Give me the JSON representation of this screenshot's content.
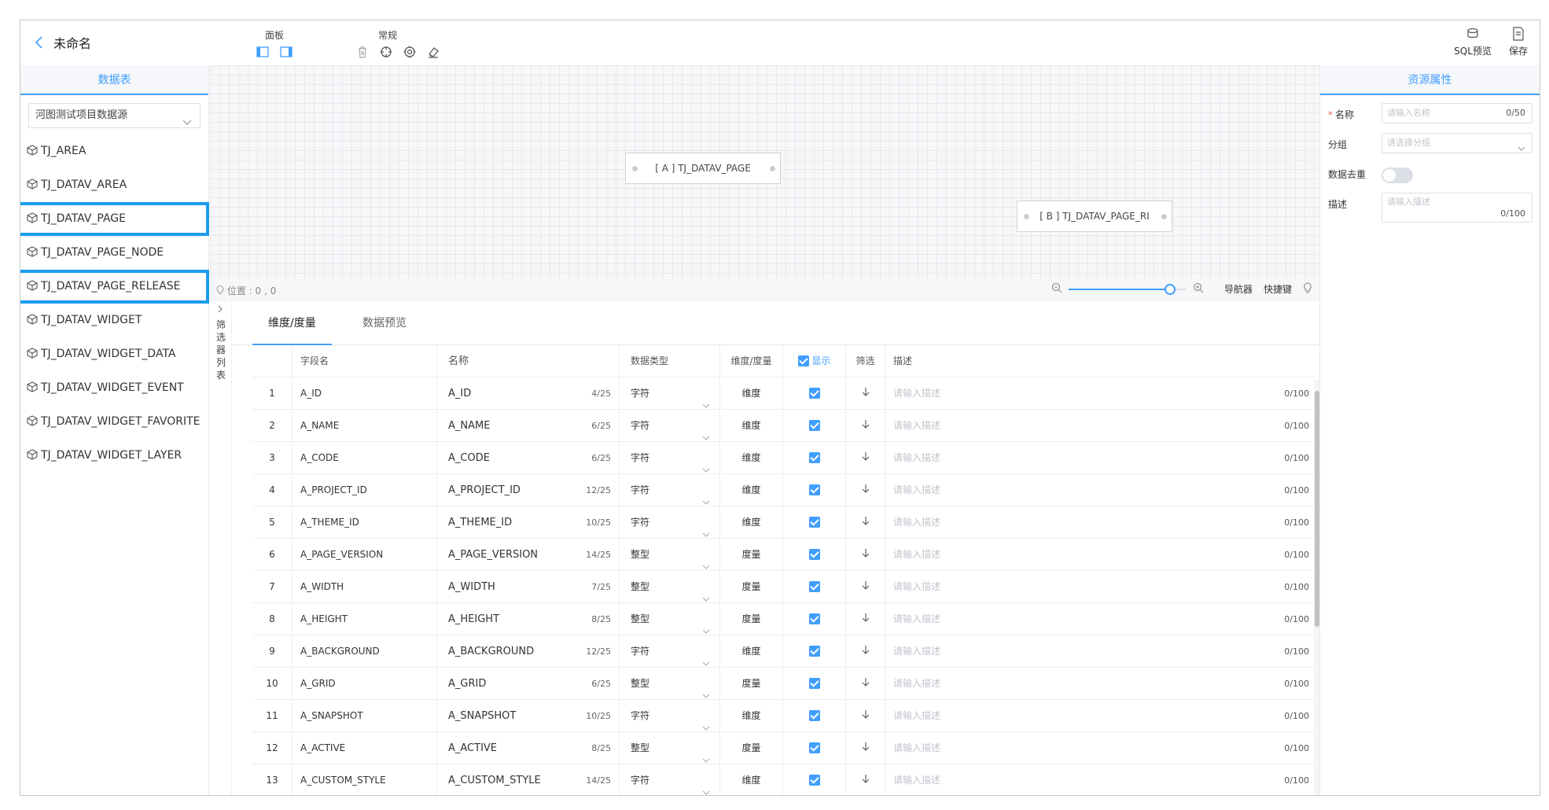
{
  "header": {
    "title": "未命名",
    "panel_label": "面板",
    "common_label": "常规",
    "sql_preview_label": "SQL预览",
    "save_label": "保存"
  },
  "left_panel": {
    "title": "数据表",
    "datasource": "河图测试项目数据源",
    "tables": [
      "TJ_AREA",
      "TJ_DATAV_AREA",
      "TJ_DATAV_PAGE",
      "TJ_DATAV_PAGE_NODE",
      "TJ_DATAV_PAGE_RELEASE",
      "TJ_DATAV_WIDGET",
      "TJ_DATAV_WIDGET_DATA",
      "TJ_DATAV_WIDGET_EVENT",
      "TJ_DATAV_WIDGET_FAVORITE",
      "TJ_DATAV_WIDGET_LAYER"
    ]
  },
  "canvas": {
    "node_a": "[ A ] TJ_DATAV_PAGE",
    "node_b": "[ B ] TJ_DATAV_PAGE_RI",
    "position": "位置 : 0 , 0",
    "navigator_label": "导航器",
    "shortcut_label": "快捷键",
    "zoom_level": 1.0
  },
  "filter_strip": {
    "label": "筛选器列表"
  },
  "bottom": {
    "tabs": [
      "维度/度量",
      "数据预览"
    ],
    "columns": {
      "field": "字段名",
      "name": "名称",
      "type": "数据类型",
      "dim": "维度/度量",
      "show": "显示",
      "filter": "筛选",
      "desc": "描述"
    },
    "desc_placeholder": "请输入描述",
    "desc_count": "0/100",
    "rows": [
      {
        "idx": "1",
        "field": "A_ID",
        "name": "A_ID",
        "count": "4/25",
        "type": "字符",
        "dim": "维度"
      },
      {
        "idx": "2",
        "field": "A_NAME",
        "name": "A_NAME",
        "count": "6/25",
        "type": "字符",
        "dim": "维度"
      },
      {
        "idx": "3",
        "field": "A_CODE",
        "name": "A_CODE",
        "count": "6/25",
        "type": "字符",
        "dim": "维度"
      },
      {
        "idx": "4",
        "field": "A_PROJECT_ID",
        "name": "A_PROJECT_ID",
        "count": "12/25",
        "type": "字符",
        "dim": "维度"
      },
      {
        "idx": "5",
        "field": "A_THEME_ID",
        "name": "A_THEME_ID",
        "count": "10/25",
        "type": "字符",
        "dim": "维度"
      },
      {
        "idx": "6",
        "field": "A_PAGE_VERSION",
        "name": "A_PAGE_VERSION",
        "count": "14/25",
        "type": "整型",
        "dim": "度量"
      },
      {
        "idx": "7",
        "field": "A_WIDTH",
        "name": "A_WIDTH",
        "count": "7/25",
        "type": "整型",
        "dim": "度量"
      },
      {
        "idx": "8",
        "field": "A_HEIGHT",
        "name": "A_HEIGHT",
        "count": "8/25",
        "type": "整型",
        "dim": "度量"
      },
      {
        "idx": "9",
        "field": "A_BACKGROUND",
        "name": "A_BACKGROUND",
        "count": "12/25",
        "type": "字符",
        "dim": "维度"
      },
      {
        "idx": "10",
        "field": "A_GRID",
        "name": "A_GRID",
        "count": "6/25",
        "type": "整型",
        "dim": "度量"
      },
      {
        "idx": "11",
        "field": "A_SNAPSHOT",
        "name": "A_SNAPSHOT",
        "count": "10/25",
        "type": "字符",
        "dim": "维度"
      },
      {
        "idx": "12",
        "field": "A_ACTIVE",
        "name": "A_ACTIVE",
        "count": "8/25",
        "type": "整型",
        "dim": "度量"
      },
      {
        "idx": "13",
        "field": "A_CUSTOM_STYLE",
        "name": "A_CUSTOM_STYLE",
        "count": "14/25",
        "type": "字符",
        "dim": "维度"
      }
    ]
  },
  "right_panel": {
    "title": "资源属性",
    "name_label": "名称",
    "name_placeholder": "请输入名称",
    "name_count": "0/50",
    "group_label": "分组",
    "group_placeholder": "请选择分组",
    "dedup_label": "数据去重",
    "desc_label": "描述",
    "desc_placeholder": "请输入描述",
    "desc_count": "0/100"
  },
  "colors": {
    "accent": "#409eff",
    "highlight": "#1a9cf0"
  }
}
